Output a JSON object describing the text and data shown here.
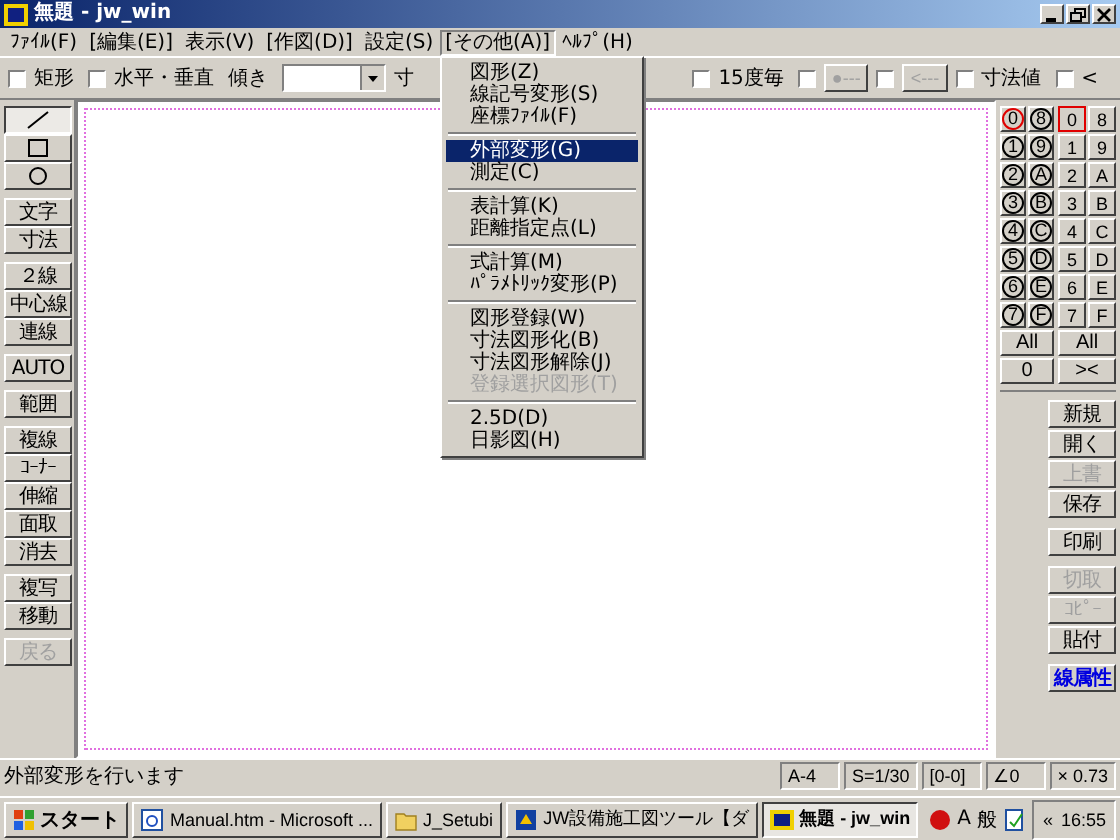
{
  "window": {
    "title": "無題 - jw_win"
  },
  "menu": [
    {
      "label": "ﾌｧｲﾙ(F)",
      "open": false
    },
    {
      "label": "[編集(E)]",
      "open": false
    },
    {
      "label": "表示(V)",
      "open": false
    },
    {
      "label": "[作図(D)]",
      "open": false
    },
    {
      "label": "設定(S)",
      "open": false
    },
    {
      "label": "[その他(A)]",
      "open": true
    },
    {
      "label": "ﾍﾙﾌﾟ(H)",
      "open": false
    }
  ],
  "dropdown": [
    {
      "kind": "item",
      "label": "図形(Z)",
      "selected": false,
      "disabled": false
    },
    {
      "kind": "item",
      "label": "線記号変形(S)",
      "selected": false,
      "disabled": false
    },
    {
      "kind": "item",
      "label": "座標ﾌｧｲﾙ(F)",
      "selected": false,
      "disabled": false
    },
    {
      "kind": "separator"
    },
    {
      "kind": "item",
      "label": "外部変形(G)",
      "selected": true,
      "disabled": false
    },
    {
      "kind": "item",
      "label": "測定(C)",
      "selected": false,
      "disabled": false
    },
    {
      "kind": "separator"
    },
    {
      "kind": "item",
      "label": "表計算(K)",
      "selected": false,
      "disabled": false
    },
    {
      "kind": "item",
      "label": "距離指定点(L)",
      "selected": false,
      "disabled": false
    },
    {
      "kind": "separator"
    },
    {
      "kind": "item",
      "label": "式計算(M)",
      "selected": false,
      "disabled": false
    },
    {
      "kind": "item",
      "label": "ﾊﾟﾗﾒﾄﾘｯｸ変形(P)",
      "selected": false,
      "disabled": false
    },
    {
      "kind": "separator"
    },
    {
      "kind": "item",
      "label": "図形登録(W)",
      "selected": false,
      "disabled": false
    },
    {
      "kind": "item",
      "label": "寸法図形化(B)",
      "selected": false,
      "disabled": false
    },
    {
      "kind": "item",
      "label": "寸法図形解除(J)",
      "selected": false,
      "disabled": false
    },
    {
      "kind": "item",
      "label": "登録選択図形(T)",
      "selected": false,
      "disabled": true
    },
    {
      "kind": "separator"
    },
    {
      "kind": "item",
      "label": "2.5D(D)",
      "selected": false,
      "disabled": false
    },
    {
      "kind": "item",
      "label": "日影図(H)",
      "selected": false,
      "disabled": false
    }
  ],
  "toolbar": {
    "left": [
      {
        "kind": "checkbox",
        "label": "矩形",
        "checked": false
      },
      {
        "kind": "checkbox",
        "label": "水平・垂直",
        "checked": false
      },
      {
        "kind": "combo",
        "label": "傾き"
      },
      {
        "kind": "text",
        "label": "寸"
      }
    ],
    "right": [
      {
        "kind": "checkbox",
        "label": "15度毎",
        "checked": false
      },
      {
        "kind": "checkbox",
        "checked": false
      },
      {
        "kind": "button",
        "label": "●---",
        "disabled": true
      },
      {
        "kind": "checkbox",
        "checked": false
      },
      {
        "kind": "button",
        "label": "<---",
        "disabled": true
      },
      {
        "kind": "checkbox",
        "label": "寸法値",
        "checked": false
      },
      {
        "kind": "checkbox",
        "label": "<",
        "checked": false
      }
    ]
  },
  "tools": [
    [
      {
        "kind": "line",
        "selected": true,
        "disabled": false
      },
      {
        "kind": "rect",
        "selected": false,
        "disabled": false
      },
      {
        "kind": "circle",
        "selected": false,
        "disabled": false
      }
    ],
    [
      {
        "kind": "text",
        "label": "文字",
        "selected": false,
        "disabled": false
      },
      {
        "kind": "text",
        "label": "寸法",
        "selected": false,
        "disabled": false
      }
    ],
    [
      {
        "kind": "text",
        "label": "２線",
        "selected": false,
        "disabled": false
      },
      {
        "kind": "text",
        "label": "中心線",
        "selected": false,
        "disabled": false
      },
      {
        "kind": "text",
        "label": "連線",
        "selected": false,
        "disabled": false
      }
    ],
    [
      {
        "kind": "text",
        "label": "AUTO",
        "selected": false,
        "disabled": false
      }
    ],
    [
      {
        "kind": "text",
        "label": "範囲",
        "selected": false,
        "disabled": false
      }
    ],
    [
      {
        "kind": "text",
        "label": "複線",
        "selected": false,
        "disabled": false
      },
      {
        "kind": "text",
        "label": "ｺｰﾅｰ",
        "selected": false,
        "disabled": false
      },
      {
        "kind": "text",
        "label": "伸縮",
        "selected": false,
        "disabled": false
      },
      {
        "kind": "text",
        "label": "面取",
        "selected": false,
        "disabled": false
      },
      {
        "kind": "text",
        "label": "消去",
        "selected": false,
        "disabled": false
      }
    ],
    [
      {
        "kind": "text",
        "label": "複写",
        "selected": false,
        "disabled": false
      },
      {
        "kind": "text",
        "label": "移動",
        "selected": false,
        "disabled": false
      }
    ],
    [
      {
        "kind": "text",
        "label": "戻る",
        "selected": false,
        "disabled": true
      }
    ]
  ],
  "layers": [
    {
      "label": "0",
      "current": true
    },
    {
      "label": "8",
      "current": false
    },
    {
      "label": "1",
      "current": false
    },
    {
      "label": "9",
      "current": false
    },
    {
      "label": "2",
      "current": false
    },
    {
      "label": "A",
      "current": false
    },
    {
      "label": "3",
      "current": false
    },
    {
      "label": "B",
      "current": false
    },
    {
      "label": "4",
      "current": false
    },
    {
      "label": "C",
      "current": false
    },
    {
      "label": "5",
      "current": false
    },
    {
      "label": "D",
      "current": false
    },
    {
      "label": "6",
      "current": false
    },
    {
      "label": "E",
      "current": false
    },
    {
      "label": "7",
      "current": false
    },
    {
      "label": "F",
      "current": false
    }
  ],
  "layer_groups": [
    {
      "label": "0",
      "current": true
    },
    {
      "label": "8",
      "current": false
    },
    {
      "label": "1",
      "current": false
    },
    {
      "label": "9",
      "current": false
    },
    {
      "label": "2",
      "current": false
    },
    {
      "label": "A",
      "current": false
    },
    {
      "label": "3",
      "current": false
    },
    {
      "label": "B",
      "current": false
    },
    {
      "label": "4",
      "current": false
    },
    {
      "label": "C",
      "current": false
    },
    {
      "label": "5",
      "current": false
    },
    {
      "label": "D",
      "current": false
    },
    {
      "label": "6",
      "current": false
    },
    {
      "label": "E",
      "current": false
    },
    {
      "label": "7",
      "current": false
    },
    {
      "label": "F",
      "current": false
    }
  ],
  "layer_buttons": [
    [
      "All",
      "0"
    ],
    [
      "All",
      "><"
    ]
  ],
  "file_buttons": [
    [
      {
        "label": "新規",
        "kind": "plain",
        "disabled": false
      },
      {
        "label": "開く",
        "kind": "plain",
        "disabled": false
      },
      {
        "label": "上書",
        "kind": "plain",
        "disabled": true
      },
      {
        "label": "保存",
        "kind": "plain",
        "disabled": false
      }
    ],
    [
      {
        "label": "印刷",
        "kind": "plain",
        "disabled": false
      }
    ],
    [
      {
        "label": "切取",
        "kind": "plain",
        "disabled": true
      },
      {
        "label": "ｺﾋﾟｰ",
        "kind": "plain",
        "disabled": true
      },
      {
        "label": "貼付",
        "kind": "plain",
        "disabled": false
      }
    ],
    [
      {
        "label": "線属性",
        "kind": "attribute",
        "disabled": false
      }
    ]
  ],
  "status_bar": {
    "message": "外部変形を行います",
    "fields": [
      "A-4",
      "S=1/30",
      "[0-0]",
      "∠0",
      "× 0.73"
    ]
  },
  "taskbar": {
    "start": "スタート",
    "tasks": [
      {
        "kind": "browser",
        "label": "Manual.htm - Microsoft ...",
        "selected": false
      },
      {
        "kind": "folder",
        "label": "J_Setubi",
        "selected": false
      },
      {
        "kind": "tool",
        "label": "JW設備施工図ツール【ダ",
        "selected": false
      },
      {
        "kind": "jw",
        "label": "無題 - jw_win",
        "selected": true
      }
    ],
    "ime": [
      "A",
      "般"
    ],
    "tray_toggle": "«",
    "clock": "16:55"
  }
}
